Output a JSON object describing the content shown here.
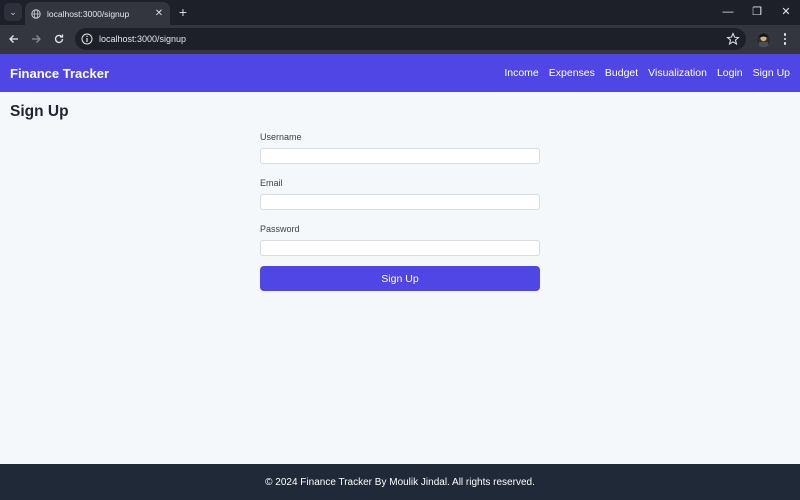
{
  "browser": {
    "tab_title": "localhost:3000/signup",
    "tab_close": "✕",
    "new_tab": "+",
    "url": "localhost:3000/signup",
    "controls": {
      "minimize": "—",
      "restore": "❐",
      "close": "✕"
    },
    "icons": [
      "tab-list-icon",
      "globe-icon",
      "back-icon",
      "forward-icon",
      "reload-icon",
      "info-icon",
      "star-icon",
      "profile-icon",
      "menu-icon"
    ]
  },
  "navbar": {
    "brand": "Finance Tracker",
    "links": [
      "Income",
      "Expenses",
      "Budget",
      "Visualization",
      "Login",
      "Sign Up"
    ],
    "color": "#4f46e5"
  },
  "page": {
    "title": "Sign Up"
  },
  "form": {
    "username_label": "Username",
    "username_value": "",
    "email_label": "Email",
    "email_value": "",
    "password_label": "Password",
    "password_value": "",
    "submit_label": "Sign Up"
  },
  "footer": {
    "text": "© 2024 Finance Tracker By Moulik Jindal. All rights reserved."
  }
}
